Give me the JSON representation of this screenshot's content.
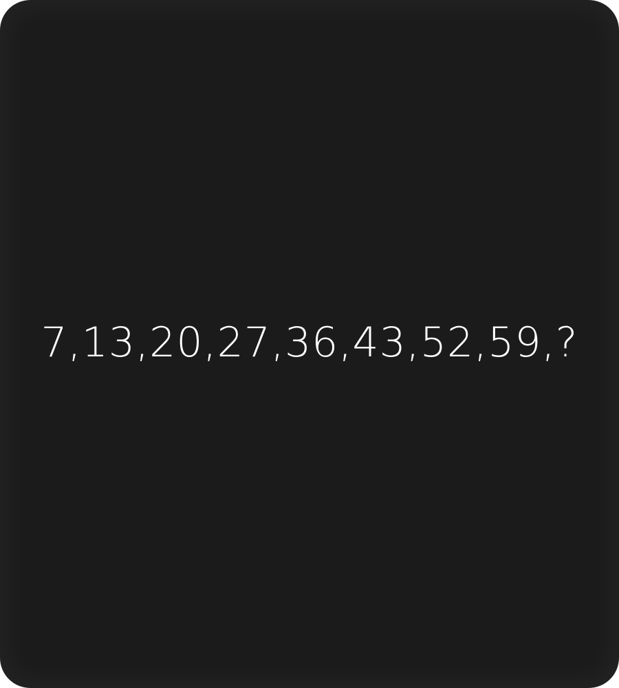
{
  "puzzle": {
    "sequence_text": "7,13,20,27,36,43,52,59,?"
  },
  "colors": {
    "background": "#1b1b1b",
    "text": "#ffffff"
  }
}
